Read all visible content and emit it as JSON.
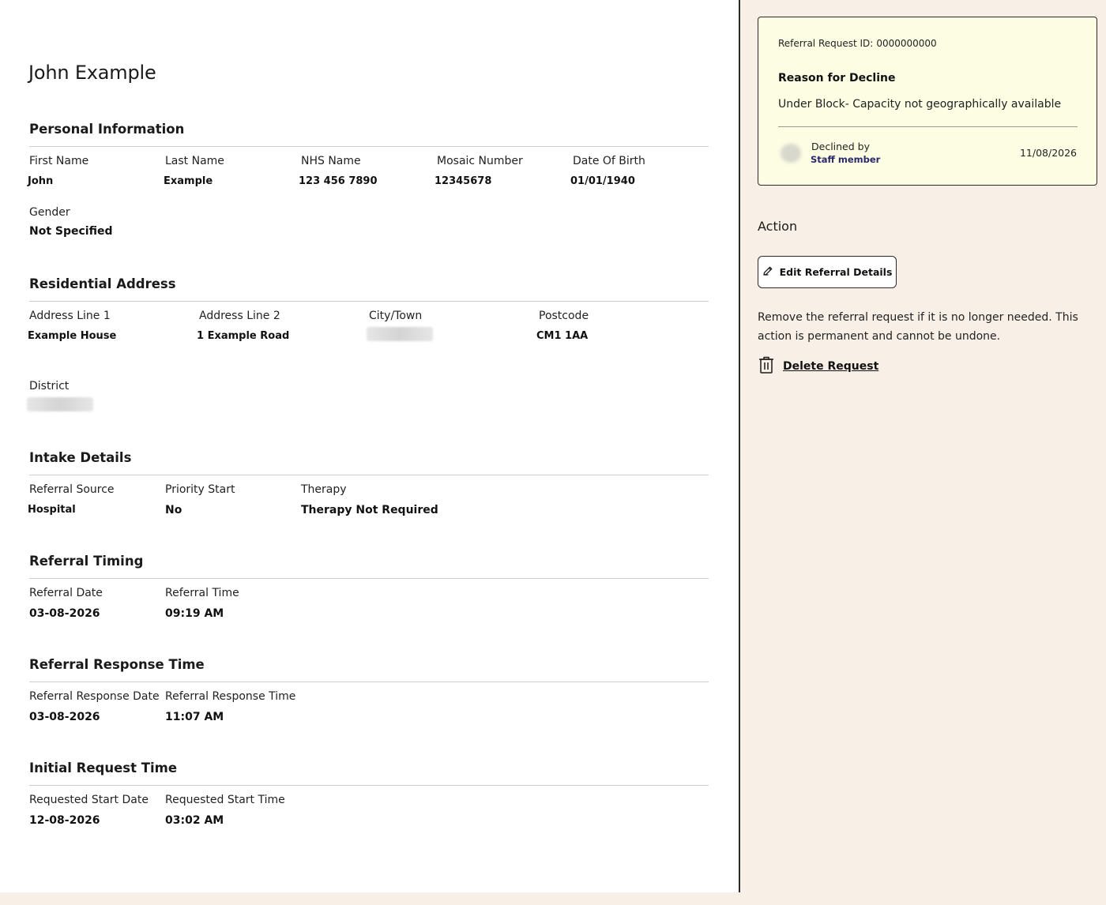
{
  "patient": {
    "name": "John Example"
  },
  "personal": {
    "title": "Personal Information",
    "fields": [
      {
        "label": "First Name",
        "value": "John"
      },
      {
        "label": "Last Name",
        "value": "Example"
      },
      {
        "label": "NHS Name",
        "value": "123 456 7890"
      },
      {
        "label": "Mosaic Number",
        "value": "12345678"
      },
      {
        "label": "Date Of Birth",
        "value": "01/01/1940"
      },
      {
        "label": "Gender",
        "value": "Not Specified"
      }
    ]
  },
  "address": {
    "title": "Residential Address",
    "fields": [
      {
        "label": "Address Line 1",
        "value": "Example House"
      },
      {
        "label": "Address Line 2",
        "value": "1 Example Road"
      },
      {
        "label": "City/Town",
        "value": ""
      },
      {
        "label": "Postcode",
        "value": "CM1 1AA"
      },
      {
        "label": "District",
        "value": ""
      }
    ]
  },
  "intake": {
    "title": "Intake Details",
    "fields": [
      {
        "label": "Referral Source",
        "value": "Hospital"
      },
      {
        "label": "Priority Start",
        "value": "No"
      },
      {
        "label": "Therapy",
        "value": "Therapy Not Required"
      }
    ]
  },
  "timing": {
    "title": "Referral Timing",
    "fields": [
      {
        "label": "Referral Date",
        "value": "03-08-2026"
      },
      {
        "label": "Referral Time",
        "value": "09:19 AM"
      }
    ]
  },
  "response": {
    "title": "Referral Response Time",
    "fields": [
      {
        "label": "Referral Response Date",
        "value": "03-08-2026"
      },
      {
        "label": "Referral Response Time",
        "value": "11:07 AM"
      }
    ]
  },
  "initial": {
    "title": "Initial Request Time",
    "fields": [
      {
        "label": "Requested Start Date",
        "value": "12-08-2026"
      },
      {
        "label": "Requested Start Time",
        "value": "03:02 AM"
      }
    ]
  },
  "decline": {
    "request_id_label": "Referral Request ID:",
    "request_id": "0000000000",
    "reason_title": "Reason for Decline",
    "reason": "Under Block- Capacity not geographically available",
    "declined_by_label": "Declined by",
    "staff": "Staff member",
    "date": "11/08/2026"
  },
  "action": {
    "title": "Action",
    "edit_label": "Edit Referral Details",
    "remove_text": "Remove the referral request if it is no longer needed. This action is permanent and cannot be undone.",
    "delete_label": "Delete Request"
  },
  "icons": {
    "edit": "pencil-icon",
    "delete": "trash-icon",
    "avatar": "avatar"
  }
}
